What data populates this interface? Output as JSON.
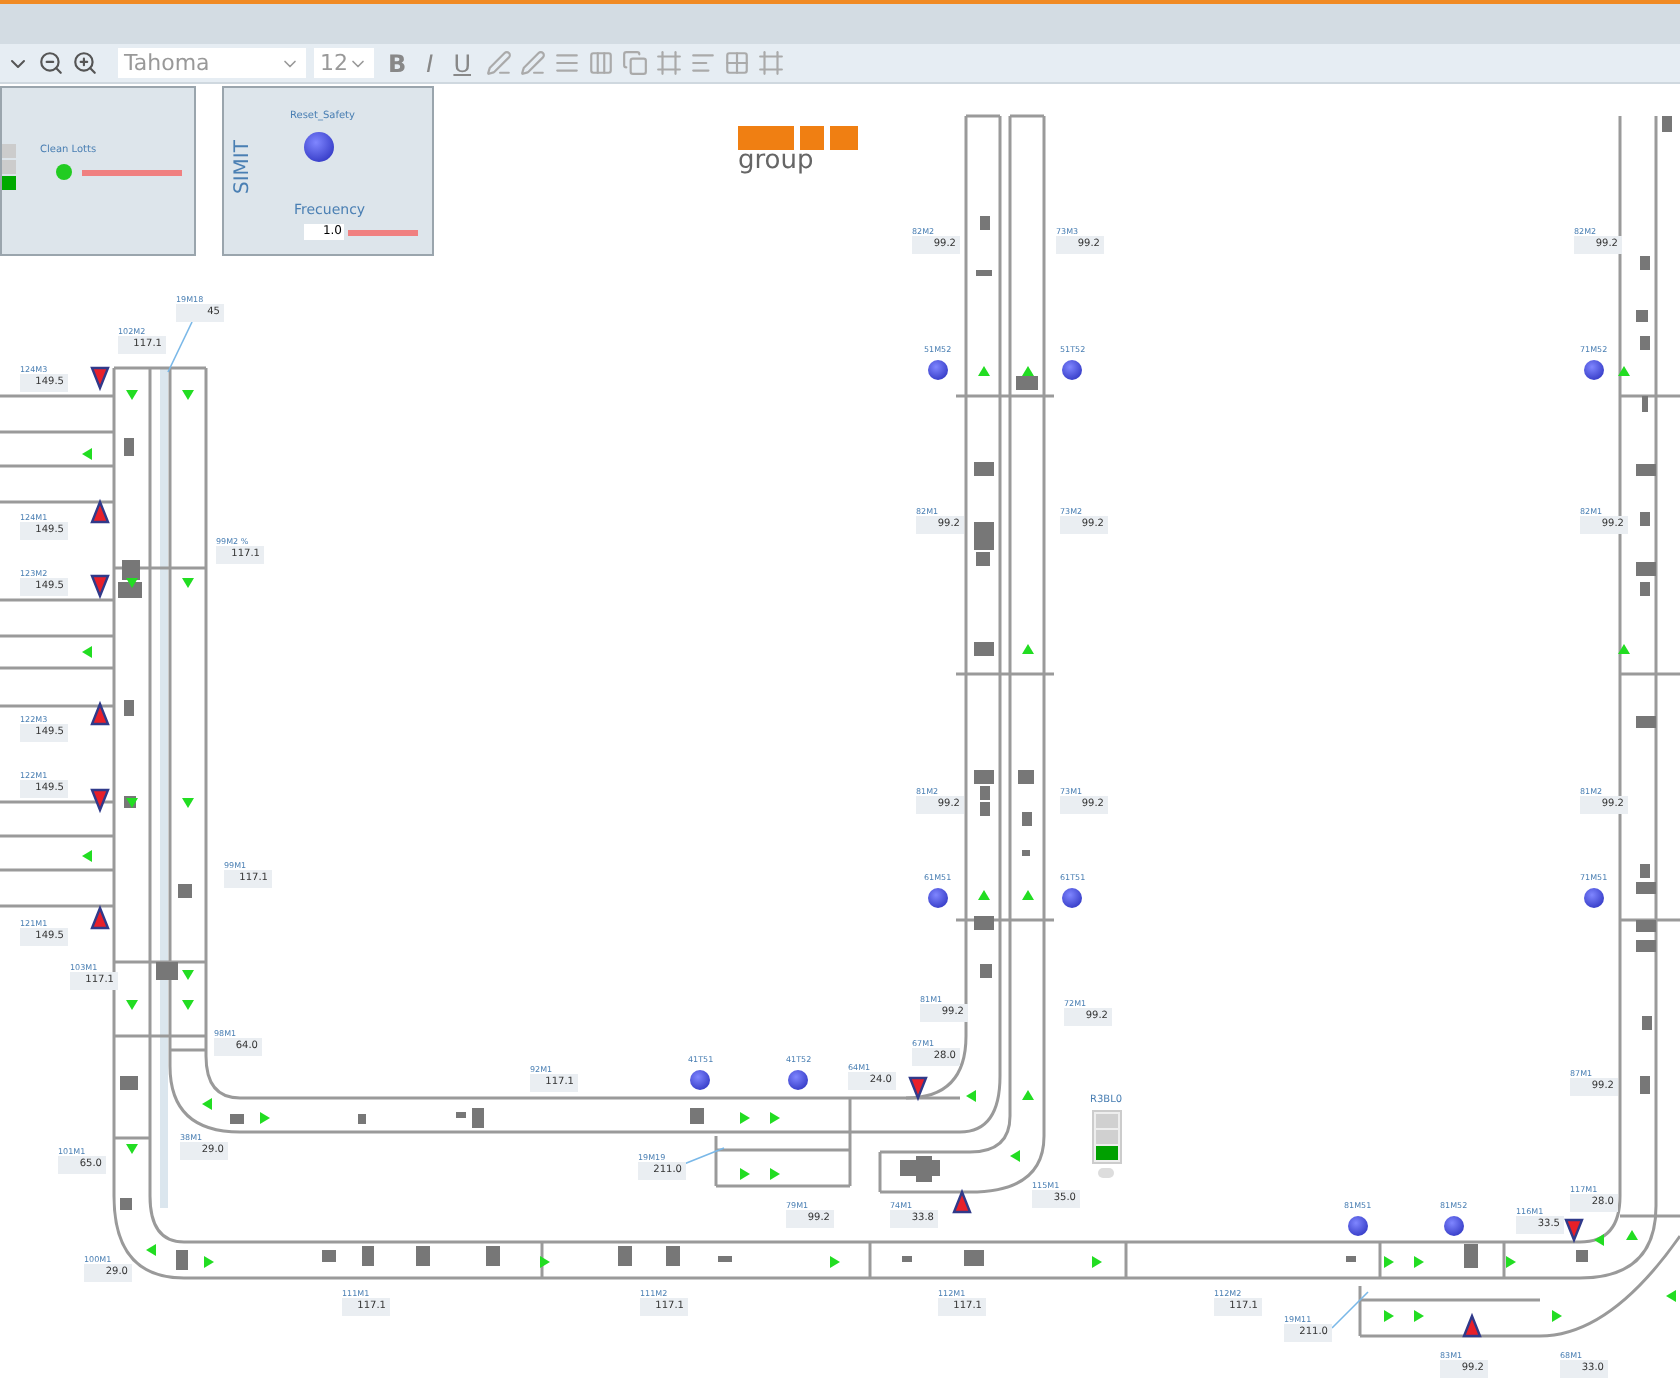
{
  "toolbar": {
    "font": "Tahoma",
    "size": "12",
    "format_buttons": [
      "B",
      "I",
      "U"
    ]
  },
  "panel_left": {
    "label": "Clean Lotts",
    "lamps": [
      {
        "on": false
      },
      {
        "on": false
      },
      {
        "on": true
      }
    ]
  },
  "panel_simit": {
    "title": "SIMIT",
    "button_label": "Reset_Safety",
    "field_label": "Frecuency",
    "field_value": "1.0"
  },
  "logo": {
    "text": "group"
  },
  "tags": [
    {
      "tag": "102M2",
      "value": "117.1"
    },
    {
      "tag": "19M18",
      "value": "45"
    },
    {
      "tag": "124M3",
      "value": "149.5"
    },
    {
      "tag": "124M1",
      "value": "149.5"
    },
    {
      "tag": "123M2",
      "value": "149.5"
    },
    {
      "tag": "122M3",
      "value": "149.5"
    },
    {
      "tag": "122M1",
      "value": "149.5"
    },
    {
      "tag": "121M1",
      "value": "149.5"
    },
    {
      "tag": "99M2 %",
      "value": "117.1"
    },
    {
      "tag": "99M1",
      "value": "117.1"
    },
    {
      "tag": "103M1",
      "value": "117.1"
    },
    {
      "tag": "98M1",
      "value": "64.0"
    },
    {
      "tag": "92M1",
      "value": "117.1"
    },
    {
      "tag": "101M1",
      "value": "65.0"
    },
    {
      "tag": "38M1",
      "value": "29.0"
    },
    {
      "tag": "19M19",
      "value": "211.0"
    },
    {
      "tag": "100M1",
      "value": "29.0"
    },
    {
      "tag": "111M1",
      "value": "117.1"
    },
    {
      "tag": "111M2",
      "value": "117.1"
    },
    {
      "tag": "82M2",
      "value": "99.2"
    },
    {
      "tag": "73M3",
      "value": "99.2"
    },
    {
      "tag": "82M1",
      "value": "99.2"
    },
    {
      "tag": "73M2",
      "value": "99.2"
    },
    {
      "tag": "81M2",
      "value": "99.2"
    },
    {
      "tag": "73M1",
      "value": "99.2"
    },
    {
      "tag": "81M1",
      "value": "99.2"
    },
    {
      "tag": "72M1",
      "value": "99.2"
    },
    {
      "tag": "64M1",
      "value": "24.0"
    },
    {
      "tag": "67M1",
      "value": "28.0"
    },
    {
      "tag": "82M2",
      "value": "99.2"
    },
    {
      "tag": "82M1",
      "value": "99.2"
    },
    {
      "tag": "81M2",
      "value": "99.2"
    },
    {
      "tag": "87M1",
      "value": "99.2"
    },
    {
      "tag": "79M1",
      "value": "99.2"
    },
    {
      "tag": "74M1",
      "value": "33.8"
    },
    {
      "tag": "115M1",
      "value": "35.0"
    },
    {
      "tag": "117M1",
      "value": "28.0"
    },
    {
      "tag": "116M1",
      "value": "33.5"
    },
    {
      "tag": "112M1",
      "value": "117.1"
    },
    {
      "tag": "112M2",
      "value": "117.1"
    },
    {
      "tag": "19M11",
      "value": "211.0"
    },
    {
      "tag": "83M1",
      "value": "99.2"
    },
    {
      "tag": "68M1",
      "value": "33.0"
    }
  ],
  "motors": [
    {
      "tag": "51M52"
    },
    {
      "tag": "51T52"
    },
    {
      "tag": "61M51"
    },
    {
      "tag": "61T51"
    },
    {
      "tag": "41T51"
    },
    {
      "tag": "41T52"
    },
    {
      "tag": "81M51"
    },
    {
      "tag": "81M52"
    },
    {
      "tag": "71M52"
    },
    {
      "tag": "71M51"
    }
  ],
  "stack_light": {
    "label": "R3BL0",
    "lamps": [
      {
        "on": false
      },
      {
        "on": false
      },
      {
        "on": true
      }
    ]
  }
}
